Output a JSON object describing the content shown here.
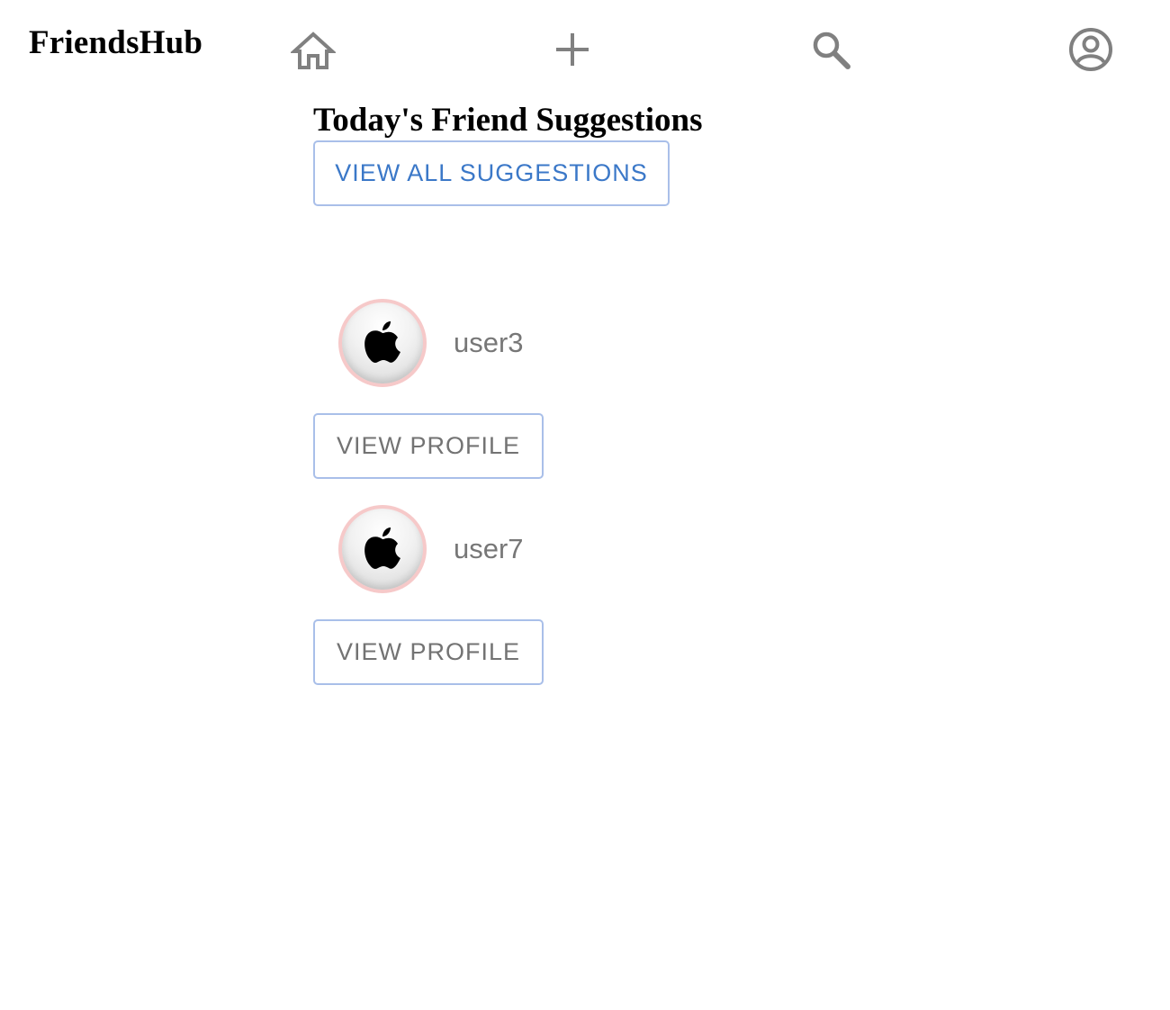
{
  "app": {
    "brand": "FriendsHub"
  },
  "nav": {
    "icons": [
      "home-icon",
      "add-icon",
      "search-icon",
      "account-circle-icon"
    ],
    "icon_color": "#808080"
  },
  "main": {
    "title": "Today's Friend Suggestions",
    "view_all_label": "VIEW ALL SUGGESTIONS",
    "suggestions": [
      {
        "username": "user3",
        "avatar_icon": "apple-logo-icon",
        "button_label": "VIEW PROFILE"
      },
      {
        "username": "user7",
        "avatar_icon": "apple-logo-icon",
        "button_label": "VIEW PROFILE"
      }
    ]
  },
  "colors": {
    "accent": "#3b78c8",
    "button_border": "#a9bfe9",
    "avatar_ring": "#f6c9c9",
    "muted_text": "#737373"
  }
}
